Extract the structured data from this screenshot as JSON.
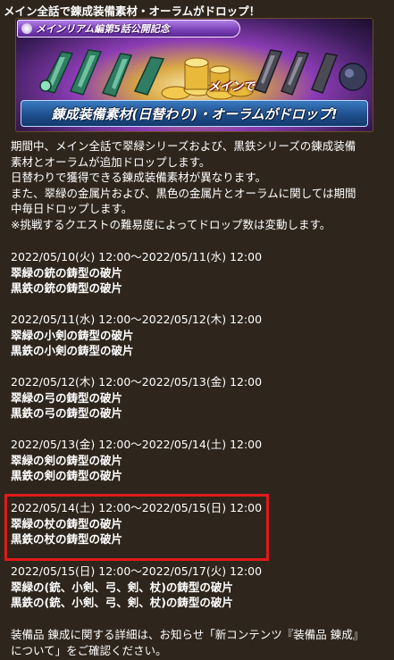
{
  "page_title": "メイン全話で錬成装備素材・オーラムがドロップ！",
  "banner": {
    "ribbon_text": "メインリアム編第5話公開記念",
    "sub_text": "メインで",
    "main_text": "錬成装備素材(日替わり)・オーラムがドロップ!",
    "accent_purple": "#7a3fb5",
    "accent_blue": "#1f4f8e",
    "accent_gold": "#d9a743"
  },
  "intro": {
    "lines": [
      "期間中、メイン全話で翠緑シリーズおよび、黒鉄シリーズの錬成装備",
      "素材とオーラムが追加ドロップします。",
      "日替わりで獲得できる錬成装備素材が異なります。",
      "また、翠緑の金属片および、黒色の金属片とオーラムに関しては期間",
      "中毎日ドロップします。",
      "※挑戦するクエストの難易度によってドロップ数は変動します。"
    ]
  },
  "schedule": [
    {
      "period": "2022/05/10(火) 12:00～2022/05/11(水) 12:00",
      "items": [
        "翠緑の銃の鋳型の破片",
        "黒鉄の銃の鋳型の破片"
      ]
    },
    {
      "period": "2022/05/11(水) 12:00～2022/05/12(木) 12:00",
      "items": [
        "翠緑の小剣の鋳型の破片",
        "黒鉄の小剣の鋳型の破片"
      ]
    },
    {
      "period": "2022/05/12(木) 12:00～2022/05/13(金) 12:00",
      "items": [
        "翠緑の弓の鋳型の破片",
        "黒鉄の弓の鋳型の破片"
      ]
    },
    {
      "period": "2022/05/13(金) 12:00～2022/05/14(土) 12:00",
      "items": [
        "翠緑の剣の鋳型の破片",
        "黒鉄の剣の鋳型の破片"
      ]
    },
    {
      "period": "2022/05/14(土) 12:00～2022/05/15(日) 12:00",
      "items": [
        "翠緑の杖の鋳型の破片",
        "黒鉄の杖の鋳型の破片"
      ]
    },
    {
      "period": "2022/05/15(日) 12:00～2022/05/17(火) 12:00",
      "items": [
        "翠緑の(銃、小剣、弓、剣、杖)の鋳型の破片",
        "黒鉄の(銃、小剣、弓、剣、杖)の鋳型の破片"
      ]
    }
  ],
  "footer": {
    "lines": [
      "装備品 錬成に関する詳細は、お知らせ「新コンテンツ『装備品 錬成』",
      "について」をご確認ください。"
    ]
  },
  "highlight": {
    "color": "#e01a1a"
  }
}
